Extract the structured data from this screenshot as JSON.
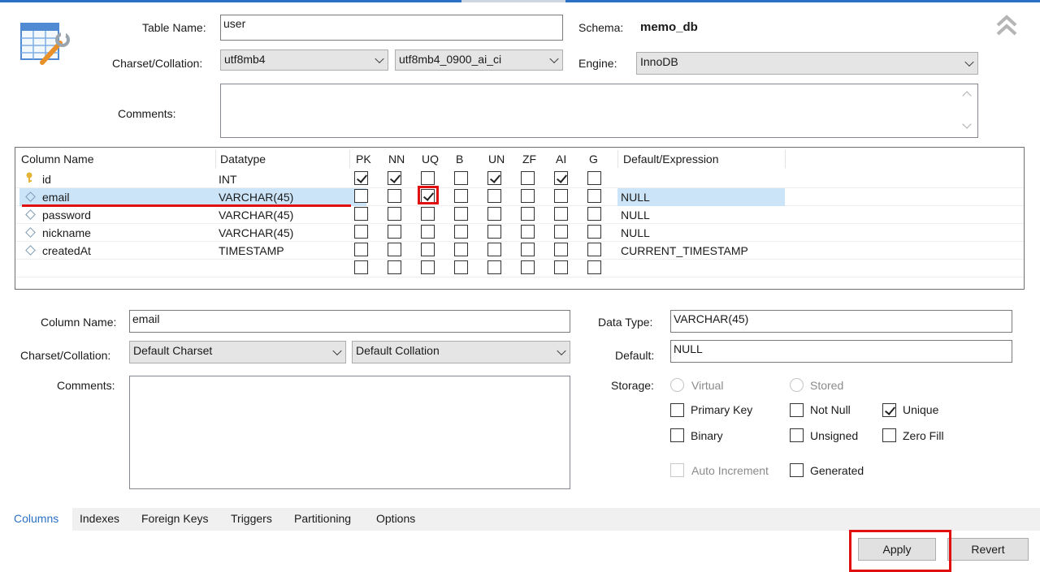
{
  "table": {
    "name_label": "Table Name:",
    "name_value": "user",
    "schema_label": "Schema:",
    "schema_value": "memo_db",
    "charset_label": "Charset/Collation:",
    "charset_value": "utf8mb4",
    "collation_value": "utf8mb4_0900_ai_ci",
    "engine_label": "Engine:",
    "engine_value": "InnoDB",
    "comments_label": "Comments:"
  },
  "grid": {
    "headers": [
      "Column Name",
      "Datatype",
      "PK",
      "NN",
      "UQ",
      "B",
      "UN",
      "ZF",
      "AI",
      "G",
      "Default/Expression"
    ],
    "rows": [
      {
        "name": "id",
        "type": "INT",
        "default": "",
        "flags": [
          true,
          true,
          false,
          false,
          true,
          false,
          true,
          false
        ]
      },
      {
        "name": "email",
        "type": "VARCHAR(45)",
        "default": "NULL",
        "flags": [
          false,
          false,
          true,
          false,
          false,
          false,
          false,
          false
        ]
      },
      {
        "name": "password",
        "type": "VARCHAR(45)",
        "default": "NULL",
        "flags": [
          false,
          false,
          false,
          false,
          false,
          false,
          false,
          false
        ]
      },
      {
        "name": "nickname",
        "type": "VARCHAR(45)",
        "default": "NULL",
        "flags": [
          false,
          false,
          false,
          false,
          false,
          false,
          false,
          false
        ]
      },
      {
        "name": "createdAt",
        "type": "TIMESTAMP",
        "default": "CURRENT_TIMESTAMP",
        "flags": [
          false,
          false,
          false,
          false,
          false,
          false,
          false,
          false
        ]
      }
    ]
  },
  "column": {
    "name_label": "Column Name:",
    "name_value": "email",
    "charset_label": "Charset/Collation:",
    "charset_value": "Default Charset",
    "collation_value": "Default Collation",
    "comments_label": "Comments:",
    "datatype_label": "Data Type:",
    "datatype_value": "VARCHAR(45)",
    "default_label": "Default:",
    "default_value": "NULL",
    "storage_label": "Storage:",
    "virtual_label": "Virtual",
    "stored_label": "Stored",
    "primary_key_label": "Primary Key",
    "not_null_label": "Not Null",
    "unique_label": "Unique",
    "binary_label": "Binary",
    "unsigned_label": "Unsigned",
    "zero_fill_label": "Zero Fill",
    "auto_increment_label": "Auto Increment",
    "generated_label": "Generated"
  },
  "tabs": [
    "Columns",
    "Indexes",
    "Foreign Keys",
    "Triggers",
    "Partitioning",
    "Options"
  ],
  "buttons": {
    "apply": "Apply",
    "revert": "Revert"
  },
  "colors": {
    "accent": "#2a71c6",
    "highlight": "#e01010",
    "selection": "#cce4f7"
  }
}
